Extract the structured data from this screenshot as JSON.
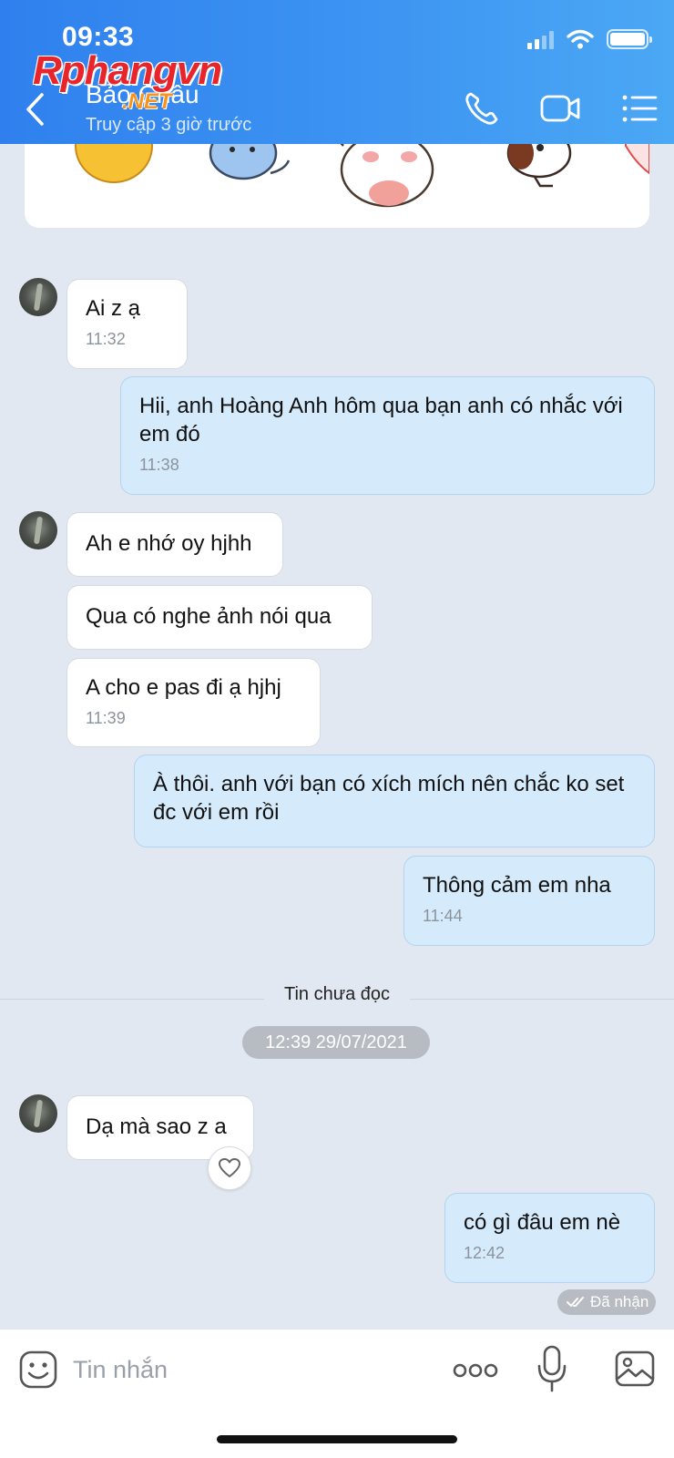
{
  "status_bar": {
    "time": "09:33"
  },
  "watermark": {
    "brand": "Rphangvn",
    "suffix": ".NET"
  },
  "header": {
    "contact_name": "Bảo Châu",
    "contact_status": "Truy cập 3 giờ trước",
    "icons": [
      "back-icon",
      "phone-icon",
      "video-call-icon",
      "menu-icon"
    ]
  },
  "messages": [
    {
      "direction": "in",
      "text": "Ai z ạ",
      "time": "11:32"
    },
    {
      "direction": "out",
      "text": "Hii, anh Hoàng Anh hôm qua bạn anh có nhắc với em đó",
      "time": "11:38"
    },
    {
      "direction": "in",
      "text": "Ah e nhớ oy hjhh",
      "time": ""
    },
    {
      "direction": "in",
      "text": "Qua có nghe ảnh nói qua",
      "time": ""
    },
    {
      "direction": "in",
      "text": "A cho e pas đi ạ hjhj",
      "time": "11:39"
    },
    {
      "direction": "out",
      "text": "À thôi. anh với bạn có xích mích nên chắc ko set đc với em rồi",
      "time": ""
    },
    {
      "direction": "out",
      "text": "Thông cảm em nha",
      "time": "11:44"
    },
    {
      "direction": "in",
      "text": "Dạ mà sao z a",
      "time": ""
    },
    {
      "direction": "out",
      "text": "có gì đâu em nè",
      "time": "12:42"
    }
  ],
  "separators": {
    "unread_label": "Tin chưa đọc",
    "date": "12:39 29/07/2021"
  },
  "delivery_status": "Đã nhận",
  "composer": {
    "placeholder": "Tin nhắn",
    "icons": [
      "emoji-icon",
      "more-icon",
      "microphone-icon",
      "image-icon"
    ]
  },
  "colors": {
    "header_gradient_start": "#2f80ee",
    "header_gradient_end": "#4ba8f4",
    "chat_background": "#e2e8f1",
    "outgoing_bubble": "#d5eafb",
    "incoming_bubble": "#ffffff"
  }
}
